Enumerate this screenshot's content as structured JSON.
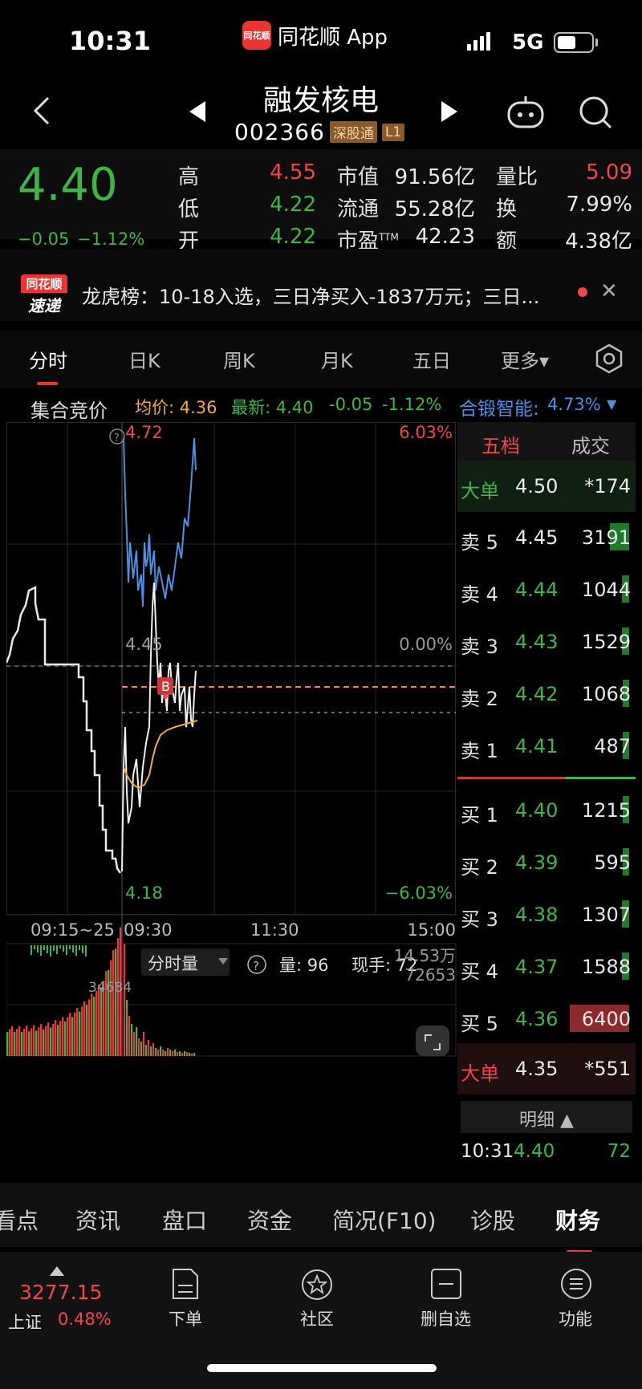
{
  "status": {
    "time": "10:31",
    "network": "5G"
  },
  "app": {
    "name": "同花顺 App",
    "logo_text": "同花顺"
  },
  "header": {
    "name": "融发核电",
    "code": "002366",
    "tag1": "深股通",
    "tag2": "L1"
  },
  "quote": {
    "price": "4.40",
    "change": "−0.05",
    "change_pct": "−1.12%",
    "high_label": "高",
    "high": "4.55",
    "low_label": "低",
    "low": "4.22",
    "open_label": "开",
    "open": "4.22",
    "mcap_label": "市值",
    "mcap": "91.56亿",
    "float_label": "流通",
    "float": "55.28亿",
    "pe_label": "市盈",
    "pe_sup": "TTM",
    "pe": "42.23",
    "volratio_label": "量比",
    "volratio": "5.09",
    "turnover_label": "换",
    "turnover": "7.99%",
    "amount_label": "额",
    "amount": "4.38亿"
  },
  "news": {
    "logo1": "同花顺",
    "logo2": "速递",
    "text": "龙虎榜：10-18入选，三日净买入-1837万元；三日..."
  },
  "tabs": [
    "分时",
    "日K",
    "周K",
    "月K",
    "五日",
    "更多▾"
  ],
  "info": {
    "auction": "集合竞价",
    "avg": "均价: 4.36",
    "latest": "最新: 4.40",
    "chg": "-0.05",
    "pct": "-1.12%",
    "smart_label": "合锻智能:",
    "smart_val": "4.73%"
  },
  "chart": {
    "top_price": "4.72",
    "top_pct": "6.03%",
    "mid_price": "4.45",
    "mid_pct": "0.00%",
    "bot_price": "4.18",
    "bot_pct": "−6.03%",
    "time_pre": "09:15~25",
    "time_open": "09:30",
    "time_mid": "11:30",
    "time_close": "15:00",
    "b_marker": "B",
    "vol_label": "分时量",
    "vol_now": "量: 96",
    "vol_hand": "现手: 72",
    "vol_max": "14.53万",
    "vol_mid": "72653",
    "vol_pre": "34684",
    "help": "?"
  },
  "orderbook": {
    "tab1": "五档",
    "tab2": "成交",
    "big_sell": {
      "name": "大单",
      "price": "4.50",
      "vol": "*174"
    },
    "asks": [
      {
        "name": "卖 5",
        "price": "4.45",
        "vol": "3191",
        "bar": 0.32
      },
      {
        "name": "卖 4",
        "price": "4.44",
        "vol": "1044",
        "bar": 0.12
      },
      {
        "name": "卖 3",
        "price": "4.43",
        "vol": "1529",
        "bar": 0.12
      },
      {
        "name": "卖 2",
        "price": "4.42",
        "vol": "1068",
        "bar": 0.1
      },
      {
        "name": "卖 1",
        "price": "4.41",
        "vol": "487",
        "bar": 0.06
      }
    ],
    "bids": [
      {
        "name": "买 1",
        "price": "4.40",
        "vol": "1215",
        "bar": 0.1
      },
      {
        "name": "买 2",
        "price": "4.39",
        "vol": "595",
        "bar": 0.06
      },
      {
        "name": "买 3",
        "price": "4.38",
        "vol": "1307",
        "bar": 0.12
      },
      {
        "name": "买 4",
        "price": "4.37",
        "vol": "1588",
        "bar": 0.12
      },
      {
        "name": "买 5",
        "price": "4.36",
        "vol": "6400",
        "bar": 1.0
      }
    ],
    "big_buy": {
      "name": "大单",
      "price": "4.35",
      "vol": "*551"
    },
    "detail_label": "明细 ▲",
    "last_trade": {
      "time": "10:31",
      "price": "4.40",
      "vol": "72"
    }
  },
  "sections": [
    "看点",
    "资讯",
    "盘口",
    "资金",
    "简况(F10)",
    "诊股",
    "财务"
  ],
  "bottom": {
    "index_val": "3277.15",
    "index_name": "上证",
    "index_pct": "0.48%",
    "order": "下单",
    "community": "社区",
    "remove_fav": "删自选",
    "func": "功能"
  },
  "colors": {
    "up": "#f2454a",
    "down": "#3fb548",
    "accent": "#e93430",
    "avg_line": "#f0a93b",
    "compare_line": "#4d8fe0"
  }
}
